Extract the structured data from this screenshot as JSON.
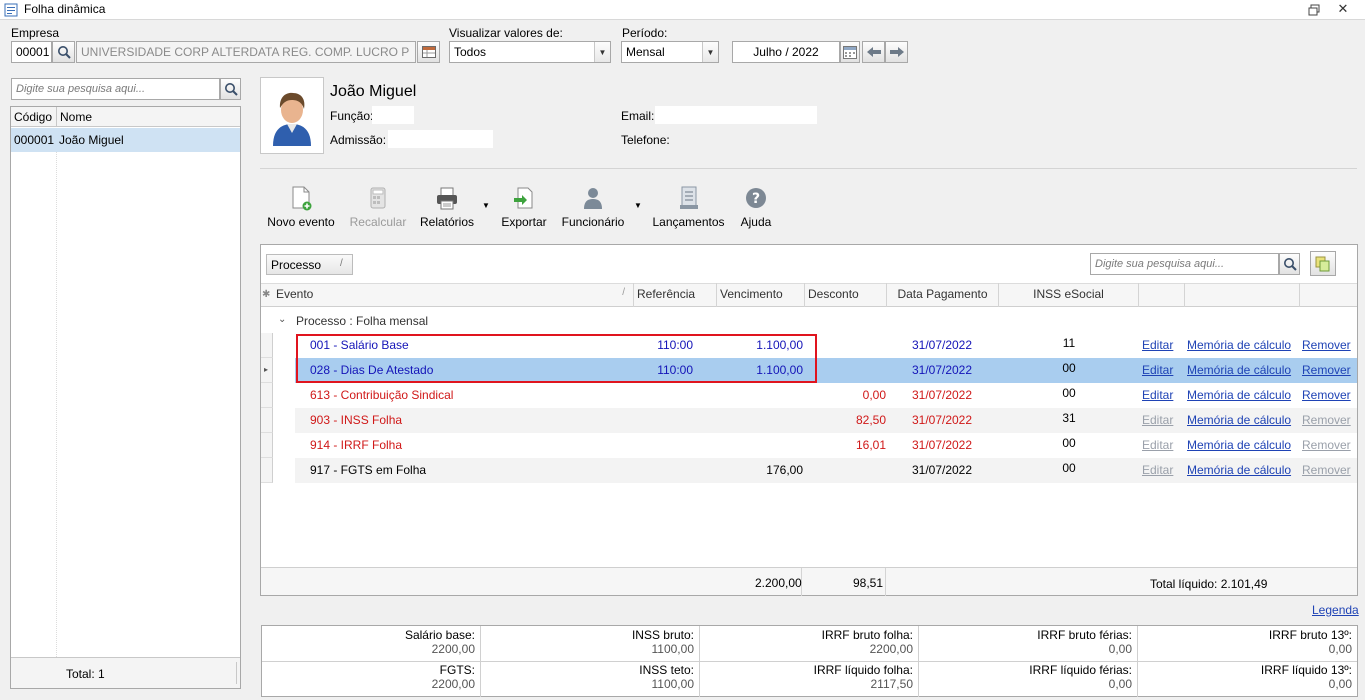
{
  "window": {
    "title": "Folha dinâmica"
  },
  "filters": {
    "empresa_label": "Empresa",
    "empresa_code": "00001",
    "empresa_name": "UNIVERSIDADE CORP ALTERDATA REG. COMP. LUCRO P",
    "visualizar_label": "Visualizar valores de:",
    "visualizar_value": "Todos",
    "periodo_label": "Período:",
    "periodo_value": "Mensal",
    "month_value": "Julho / 2022"
  },
  "left": {
    "search_placeholder": "Digite sua pesquisa aqui...",
    "col_codigo": "Código",
    "col_nome": "Nome",
    "rows": [
      {
        "codigo": "000001",
        "nome": "João Miguel"
      }
    ],
    "total": "Total: 1"
  },
  "employee": {
    "name": "João Miguel",
    "funcao_label": "Função:",
    "admissao_label": "Admissão:",
    "email_label": "Email:",
    "telefone_label": "Telefone:"
  },
  "toolbar": {
    "novo_evento": "Novo evento",
    "recalcular": "Recalcular",
    "relatorios": "Relatórios",
    "exportar": "Exportar",
    "funcionario": "Funcionário",
    "lancamentos": "Lançamentos",
    "ajuda": "Ajuda"
  },
  "grid": {
    "group_button": "Processo",
    "search_placeholder": "Digite sua pesquisa aqui...",
    "headers": {
      "evento": "Evento",
      "referencia": "Referência",
      "vencimento": "Vencimento",
      "desconto": "Desconto",
      "data_pagamento": "Data Pagamento",
      "inss": "INSS eSocial"
    },
    "group_row": "Processo : Folha mensal",
    "rows": [
      {
        "evento": "001 - Salário Base",
        "referencia": "110:00",
        "vencimento": "1.100,00",
        "desconto": "",
        "data": "31/07/2022",
        "inss": "11",
        "editar": "Editar",
        "memoria": "Memória de cálculo",
        "remover": "Remover"
      },
      {
        "evento": "028 - Dias De Atestado",
        "referencia": "110:00",
        "vencimento": "1.100,00",
        "desconto": "",
        "data": "31/07/2022",
        "inss": "00",
        "editar": "Editar",
        "memoria": "Memória de cálculo",
        "remover": "Remover"
      },
      {
        "evento": "613 - Contribuição Sindical",
        "referencia": "",
        "vencimento": "",
        "desconto": "0,00",
        "data": "31/07/2022",
        "inss": "00",
        "editar": "Editar",
        "memoria": "Memória de cálculo",
        "remover": "Remover"
      },
      {
        "evento": "903 - INSS Folha",
        "referencia": "",
        "vencimento": "",
        "desconto": "82,50",
        "data": "31/07/2022",
        "inss": "31",
        "editar": "Editar",
        "memoria": "Memória de cálculo",
        "remover": "Remover"
      },
      {
        "evento": "914 - IRRF Folha",
        "referencia": "",
        "vencimento": "",
        "desconto": "16,01",
        "data": "31/07/2022",
        "inss": "00",
        "editar": "Editar",
        "memoria": "Memória de cálculo",
        "remover": "Remover"
      },
      {
        "evento": "917 - FGTS em Folha",
        "referencia": "",
        "vencimento": "176,00",
        "desconto": "",
        "data": "31/07/2022",
        "inss": "00",
        "editar": "Editar",
        "memoria": "Memória de cálculo",
        "remover": "Remover"
      }
    ],
    "totals": {
      "vencimento": "2.200,00",
      "desconto": "98,51",
      "liquido": "Total líquido: 2.101,49"
    },
    "legenda": "Legenda"
  },
  "summary": {
    "salario_base_label": "Salário base:",
    "salario_base": "2200,00",
    "inss_bruto_label": "INSS bruto:",
    "inss_bruto": "1100,00",
    "irrf_bruto_folha_label": "IRRF bruto folha:",
    "irrf_bruto_folha": "2200,00",
    "irrf_bruto_ferias_label": "IRRF bruto férias:",
    "irrf_bruto_ferias": "0,00",
    "irrf_bruto_13_label": "IRRF bruto 13º:",
    "irrf_bruto_13": "0,00",
    "fgts_label": "FGTS:",
    "fgts": "2200,00",
    "inss_teto_label": "INSS teto:",
    "inss_teto": "1100,00",
    "irrf_liquido_folha_label": "IRRF líquido folha:",
    "irrf_liquido_folha": "2117,50",
    "irrf_liquido_ferias_label": "IRRF líquido férias:",
    "irrf_liquido_ferias": "0,00",
    "irrf_liquido_13_label": "IRRF líquido 13º:",
    "irrf_liquido_13": "0,00"
  },
  "colors": {
    "selected_row": "#a9cdef",
    "highlight_border": "#e0141e",
    "link": "#1f43b5",
    "discount_red": "#d01818",
    "value_blue": "#1414b8"
  }
}
